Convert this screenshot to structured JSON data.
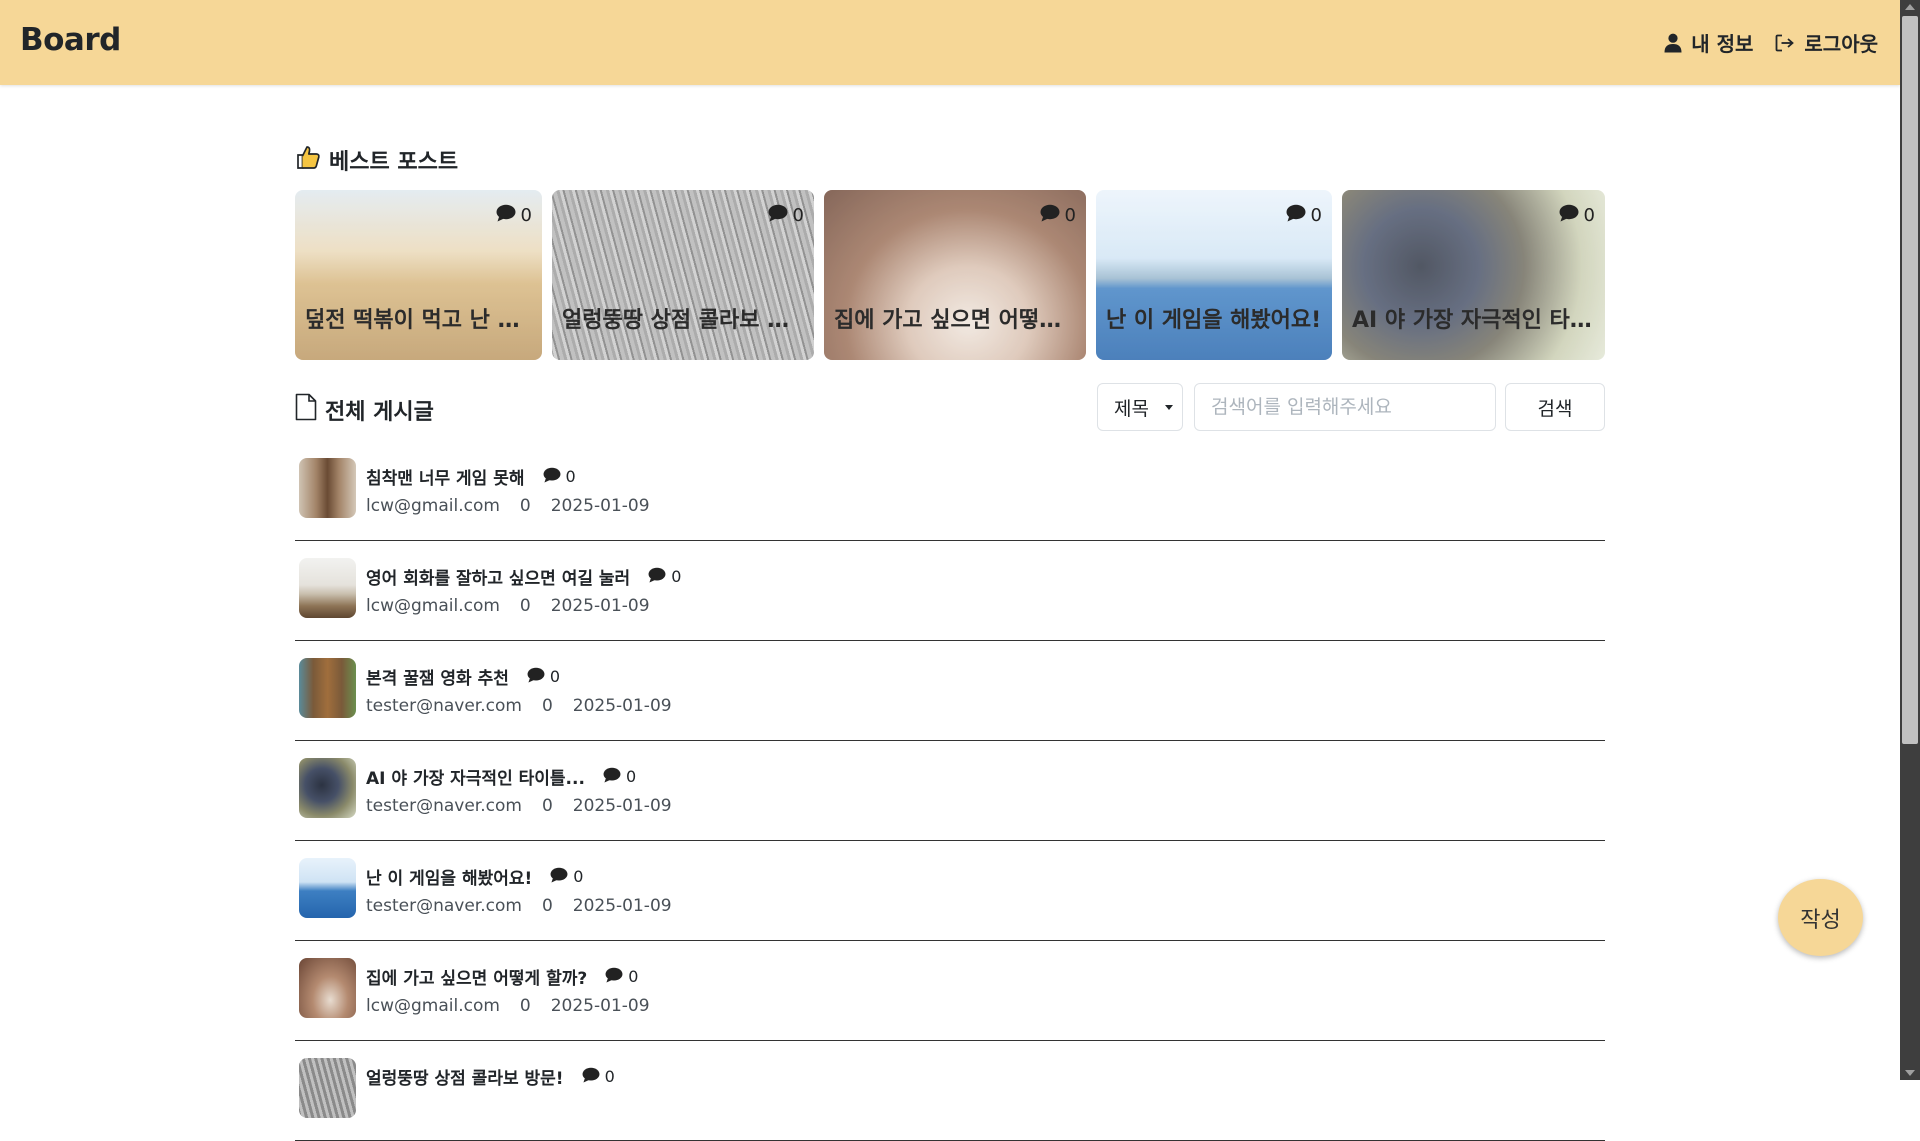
{
  "header": {
    "logo": "Board",
    "my_info_label": "내 정보",
    "logout_label": "로그아웃",
    "background_color": "#f6d797"
  },
  "best": {
    "title": "베스트 포스트",
    "icon": "thumbs-up-icon",
    "items": [
      {
        "title": "덮전 떡볶이 먹고 난 후기",
        "comments": "0",
        "image": "beach-swing-photo"
      },
      {
        "title": "얼렁뚱땅 상점 콜라보 방문!",
        "comments": "0",
        "image": "grass-bw-photo"
      },
      {
        "title": "집에 가고 싶으면 어떻게 할까?",
        "comments": "0",
        "image": "baseball-glove-photo"
      },
      {
        "title": "난 이 게임을 해봤어요!",
        "comments": "0",
        "image": "city-sea-photo"
      },
      {
        "title": "AI 야 가장 자극적인 타이틀 만들어줘",
        "comments": "0",
        "image": "grapes-photo"
      }
    ]
  },
  "all_posts": {
    "title": "전체 게시글",
    "icon": "document-icon"
  },
  "search": {
    "select_value": "제목",
    "placeholder": "검색어를 입력해주세요",
    "button_label": "검색"
  },
  "posts": [
    {
      "title": "침착맨 너무 게임 못해",
      "comments": "0",
      "author": "lcw@gmail.com",
      "views": "0",
      "date": "2025-01-09",
      "thumb": "old-door-photo"
    },
    {
      "title": "영어 회화를 잘하고 싶으면 여길 눌러",
      "comments": "0",
      "author": "lcw@gmail.com",
      "views": "0",
      "date": "2025-01-09",
      "thumb": "pier-photo"
    },
    {
      "title": "본격 꿀잼 영화 추천",
      "comments": "0",
      "author": "tester@naver.com",
      "views": "0",
      "date": "2025-01-09",
      "thumb": "wooden-door-photo"
    },
    {
      "title": "AI 야 가장 자극적인 타이틀...",
      "comments": "0",
      "author": "tester@naver.com",
      "views": "0",
      "date": "2025-01-09",
      "thumb": "grapes-photo"
    },
    {
      "title": "난 이 게임을 해봤어요!",
      "comments": "0",
      "author": "tester@naver.com",
      "views": "0",
      "date": "2025-01-09",
      "thumb": "city-sea-photo"
    },
    {
      "title": "집에 가고 싶으면 어떻게 할까?",
      "comments": "0",
      "author": "lcw@gmail.com",
      "views": "0",
      "date": "2025-01-09",
      "thumb": "baseball-glove-photo"
    },
    {
      "title": "얼렁뚱땅 상점 콜라보 방문!",
      "comments": "0",
      "author": "",
      "views": "",
      "date": "",
      "thumb": "grass-bw-photo"
    }
  ],
  "fab_label": "작성"
}
